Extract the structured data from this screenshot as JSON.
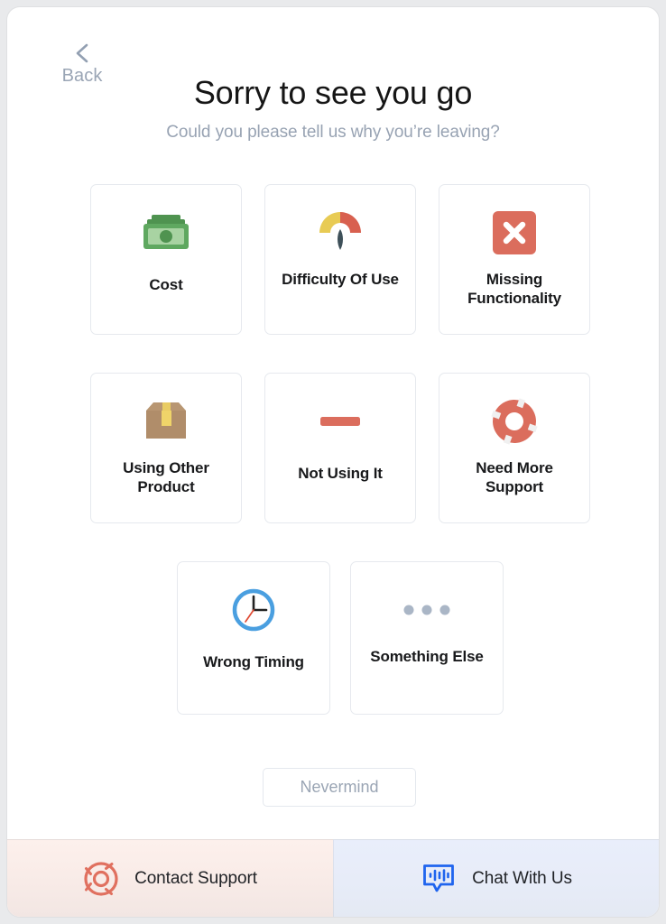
{
  "back": {
    "label": "Back",
    "icon": "chevron-left-icon"
  },
  "header": {
    "title": "Sorry to see you go",
    "subtitle": "Could you please tell us why you’re leaving?"
  },
  "options": [
    {
      "id": "cost",
      "label": "Cost",
      "icon": "money-icon"
    },
    {
      "id": "difficulty-of-use",
      "label": "Difficulty Of Use",
      "icon": "gauge-icon"
    },
    {
      "id": "missing-functionality",
      "label": "Missing Functionality",
      "icon": "x-square-icon"
    },
    {
      "id": "using-other-product",
      "label": "Using Other Product",
      "icon": "box-icon"
    },
    {
      "id": "not-using-it",
      "label": "Not Using It",
      "icon": "minus-icon"
    },
    {
      "id": "need-more-support",
      "label": "Need More Support",
      "icon": "life-ring-icon"
    },
    {
      "id": "wrong-timing",
      "label": "Wrong Timing",
      "icon": "clock-icon"
    },
    {
      "id": "something-else",
      "label": "Something Else",
      "icon": "ellipsis-icon"
    }
  ],
  "nevermind": {
    "label": "Nevermind"
  },
  "footer": {
    "contact_support": {
      "label": "Contact Support",
      "icon": "life-ring-outline-icon"
    },
    "chat_with_us": {
      "label": "Chat With Us",
      "icon": "chat-bubble-waveform-icon"
    }
  },
  "colors": {
    "title": "#161616",
    "subtitle": "#98a3b3",
    "muted": "#9aa5b4",
    "card_border": "#e6e9ee",
    "money_green": "#5aa05a",
    "gauge_yellow": "#e8cb54",
    "gauge_red": "#d8604f",
    "gauge_needle": "#3e5059",
    "salmon": "#db6d5d",
    "box_brown": "#b08d6a",
    "box_tape": "#efd469",
    "clock_blue": "#4a9fe0",
    "chat_blue": "#1f64ee",
    "support_bg": "#f8ebe7",
    "chat_bg": "#e7ecf8"
  }
}
